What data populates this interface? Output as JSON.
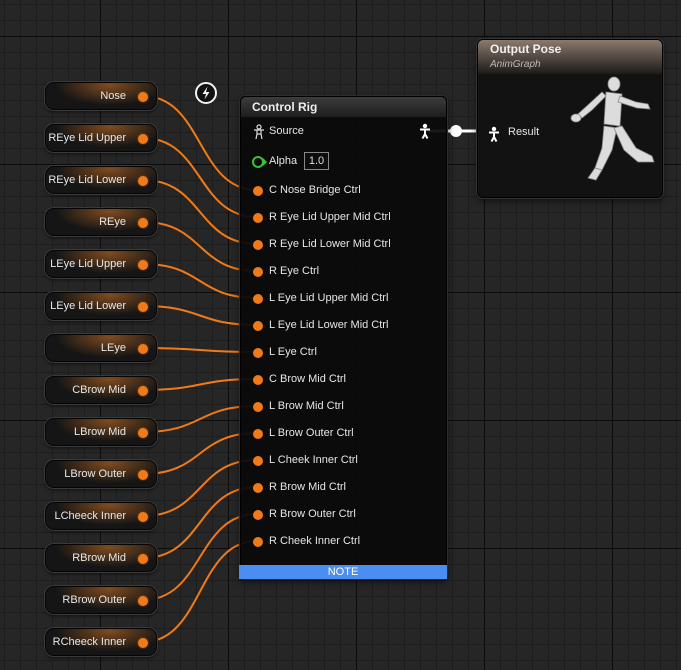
{
  "variables": [
    {
      "label": "Nose"
    },
    {
      "label": "REye Lid Upper"
    },
    {
      "label": "REye Lid Lower"
    },
    {
      "label": "REye"
    },
    {
      "label": "LEye Lid Upper"
    },
    {
      "label": "LEye Lid Lower"
    },
    {
      "label": "LEye"
    },
    {
      "label": "CBrow Mid"
    },
    {
      "label": "LBrow Mid"
    },
    {
      "label": "LBrow Outer"
    },
    {
      "label": "LCheeck Inner"
    },
    {
      "label": "RBrow Mid"
    },
    {
      "label": "RBrow Outer"
    },
    {
      "label": "RCheeck Inner"
    }
  ],
  "control_rig": {
    "title": "Control Rig",
    "source_label": "Source",
    "alpha_label": "Alpha",
    "alpha_value": "1.0",
    "inputs": [
      "C Nose Bridge Ctrl",
      "R Eye Lid Upper Mid Ctrl",
      "R Eye Lid Lower Mid Ctrl",
      "R Eye Ctrl",
      "L Eye Lid Upper Mid Ctrl",
      "L Eye Lid Lower Mid Ctrl",
      "L Eye Ctrl",
      "C Brow Mid Ctrl",
      "L Brow Mid Ctrl",
      "L Brow Outer Ctrl",
      "L Cheek Inner Ctrl",
      "R Brow Mid Ctrl",
      "R Brow Outer Ctrl",
      "R Cheek Inner Ctrl"
    ],
    "note_label": "NOTE"
  },
  "output_pose": {
    "title": "Output Pose",
    "subtitle": "AnimGraph",
    "result_label": "Result"
  },
  "colors": {
    "float_pin": "#f07a18",
    "exec_green": "#38c43a",
    "note_blue": "#4b8ef2",
    "grid_bg": "#262626"
  },
  "icons": [
    "lightning-icon",
    "pose-pin-icon",
    "mannequin-icon"
  ]
}
